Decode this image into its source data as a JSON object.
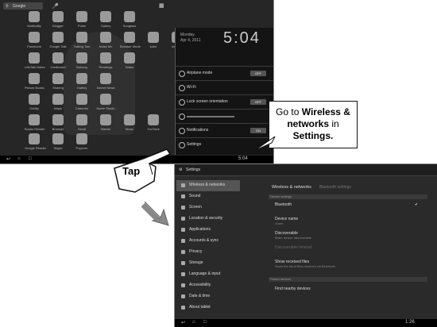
{
  "home": {
    "search": "Google",
    "apps_menu": "Apps",
    "apps_row1": [
      "Notifcality",
      "Blogger",
      "Pulse",
      "Gallery",
      "Sunglass"
    ],
    "apps_row2": [
      "Facebook",
      "Google Talk",
      "Talking Tom",
      "Noise Mx",
      "Browser Mode",
      "kobo",
      "Android"
    ],
    "apps_row3": [
      "LilisTalk Notes",
      "Cardboard",
      "Bobzog",
      "Readings",
      "Notes"
    ],
    "apps_row4": [
      "Picture Books",
      "Sharing",
      "Gallery",
      "Secret News"
    ],
    "apps_row5": [
      "Oddity",
      "Maps",
      "Calendar",
      "Movie Studio"
    ],
    "apps_row6": [
      "Books Reader",
      "Browser",
      "Gmail",
      "Market",
      "Music",
      "YouTube"
    ],
    "apps_row7": [
      "Google Reader",
      "Skype",
      "Popcorn"
    ]
  },
  "quick_settings": {
    "date_line": "Monday",
    "date": "Apr 4, 2011",
    "clock": "5:04",
    "rows": [
      {
        "label": "Airplane mode",
        "toggle": "OFF"
      },
      {
        "label": "Wi-Fi",
        "toggle": ""
      },
      {
        "label": "Lock screen orientation",
        "toggle": "OFF"
      },
      {
        "label": "",
        "toggle": ""
      },
      {
        "label": "Notifications",
        "toggle": "ON"
      },
      {
        "label": "Settings",
        "toggle": ""
      }
    ]
  },
  "callout": {
    "prefix": "Go to",
    "bold1": "Wireless &",
    "mid": "networks",
    "in": "in",
    "bold2": "Settings."
  },
  "tap_label": "Tap",
  "settings": {
    "title": "Settings",
    "menu": [
      "Wireless & networks",
      "Sound",
      "Screen",
      "Location & security",
      "Applications",
      "Accounts & sync",
      "Privacy",
      "Storage",
      "Language & input",
      "Accessibility",
      "Date & time",
      "About tablet"
    ],
    "detail_title": "Wireless & networks",
    "detail_subtitle": "Bluetooth settings",
    "section1": "Device settings",
    "items": [
      "Bluetooth",
      "Device name",
      "Discoverable",
      "Discoverable timeout",
      "Show received files"
    ],
    "item_sub": [
      "",
      "Xoom",
      "Make device discoverable",
      "",
      "Show the list of files received via Bluetooth"
    ],
    "section2": "Paired devices",
    "find": "Find nearby devices"
  },
  "statusbar": {
    "time1": "5:04",
    "time2": "1:26"
  }
}
